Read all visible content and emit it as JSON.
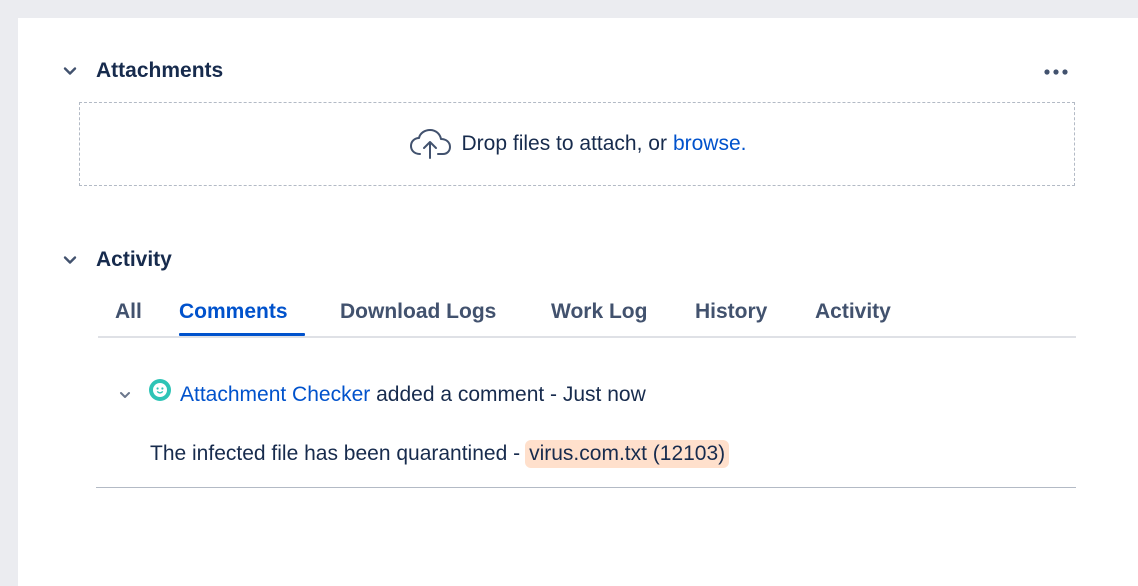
{
  "attachments": {
    "title": "Attachments",
    "more_icon": "more-horizontal-icon",
    "dropzone": {
      "icon": "cloud-upload-icon",
      "text": "Drop files to attach, or",
      "browse_link": "browse."
    }
  },
  "activity": {
    "title": "Activity",
    "tabs": [
      {
        "label": "All",
        "active": false
      },
      {
        "label": "Comments",
        "active": true
      },
      {
        "label": "Download Logs",
        "active": false
      },
      {
        "label": "Work Log",
        "active": false
      },
      {
        "label": "History",
        "active": false
      },
      {
        "label": "Activity",
        "active": false
      }
    ],
    "comment": {
      "author": "Attachment Checker",
      "action": " added a comment - ",
      "time": "Just now",
      "body_text": "The infected file has been quarantined -",
      "file_chip": "virus.com.txt (12103)",
      "avatar_icon": "bot-avatar-icon"
    }
  },
  "colors": {
    "link": "#0052cc",
    "text": "#172b4d",
    "tab_inactive": "#42526e",
    "chip_bg": "#ffe0cc",
    "avatar": "#2ec4b6",
    "background": "#ebecf0",
    "panel": "#ffffff"
  }
}
